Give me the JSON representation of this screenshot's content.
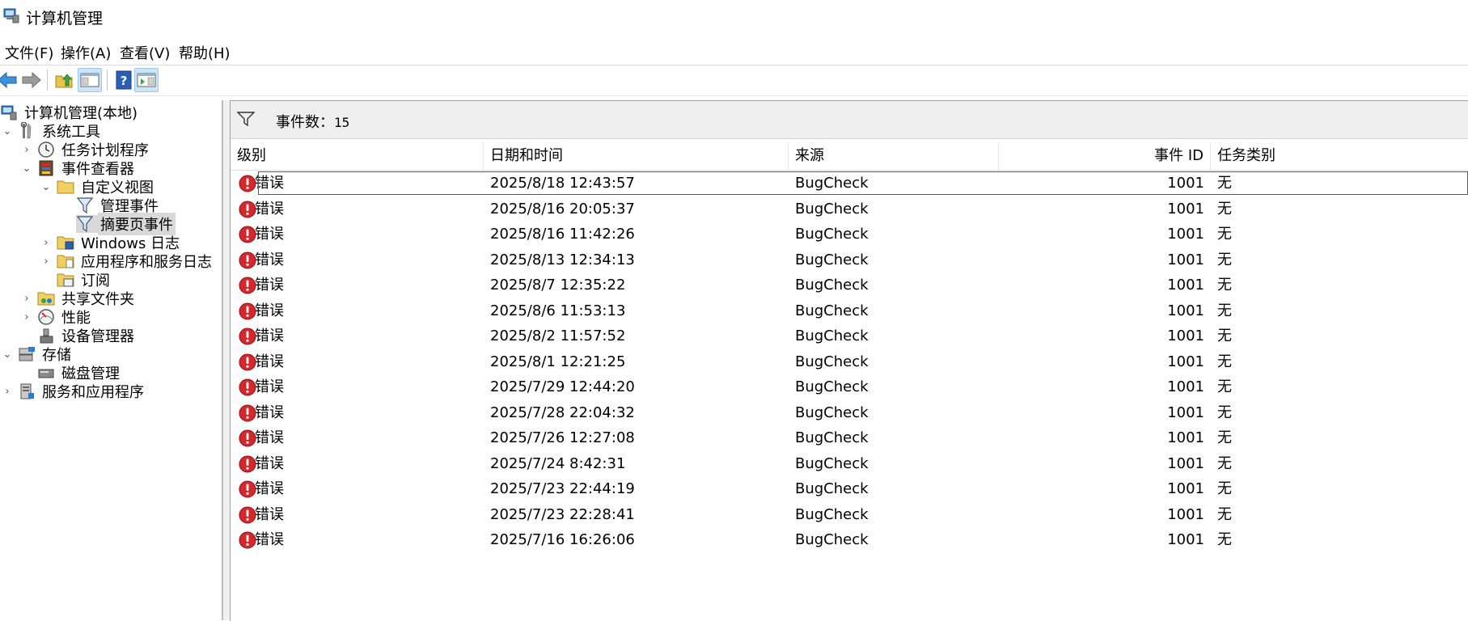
{
  "window": {
    "title": "计算机管理"
  },
  "menu": [
    "文件(F)",
    "操作(A)",
    "查看(V)",
    "帮助(H)"
  ],
  "toolbar": {
    "buttons": [
      "back-icon",
      "forward-icon",
      "up-folder-icon",
      "show-hide-tree-icon",
      "help-icon",
      "show-action-pane-icon"
    ]
  },
  "tree": {
    "root": "计算机管理(本地)",
    "system_tools": "系统工具",
    "task_scheduler": "任务计划程序",
    "event_viewer": "事件查看器",
    "custom_views": "自定义视图",
    "admin_events": "管理事件",
    "summary_events": "摘要页事件",
    "windows_logs": "Windows 日志",
    "app_service_logs": "应用程序和服务日志",
    "subscriptions": "订阅",
    "shared_folders": "共享文件夹",
    "performance": "性能",
    "device_manager": "设备管理器",
    "storage": "存储",
    "disk_management": "磁盘管理",
    "services_apps": "服务和应用程序"
  },
  "events": {
    "count_label": "事件数：",
    "count": "15",
    "columns": {
      "level": "级别",
      "datetime": "日期和时间",
      "source": "来源",
      "event_id": "事件 ID",
      "task_category": "任务类别"
    },
    "rows": [
      {
        "level": "错误",
        "datetime": "2025/8/18 12:43:57",
        "source": "BugCheck",
        "event_id": "1001",
        "task_category": "无"
      },
      {
        "level": "错误",
        "datetime": "2025/8/16 20:05:37",
        "source": "BugCheck",
        "event_id": "1001",
        "task_category": "无"
      },
      {
        "level": "错误",
        "datetime": "2025/8/16 11:42:26",
        "source": "BugCheck",
        "event_id": "1001",
        "task_category": "无"
      },
      {
        "level": "错误",
        "datetime": "2025/8/13 12:34:13",
        "source": "BugCheck",
        "event_id": "1001",
        "task_category": "无"
      },
      {
        "level": "错误",
        "datetime": "2025/8/7 12:35:22",
        "source": "BugCheck",
        "event_id": "1001",
        "task_category": "无"
      },
      {
        "level": "错误",
        "datetime": "2025/8/6 11:53:13",
        "source": "BugCheck",
        "event_id": "1001",
        "task_category": "无"
      },
      {
        "level": "错误",
        "datetime": "2025/8/2 11:57:52",
        "source": "BugCheck",
        "event_id": "1001",
        "task_category": "无"
      },
      {
        "level": "错误",
        "datetime": "2025/8/1 12:21:25",
        "source": "BugCheck",
        "event_id": "1001",
        "task_category": "无"
      },
      {
        "level": "错误",
        "datetime": "2025/7/29 12:44:20",
        "source": "BugCheck",
        "event_id": "1001",
        "task_category": "无"
      },
      {
        "level": "错误",
        "datetime": "2025/7/28 22:04:32",
        "source": "BugCheck",
        "event_id": "1001",
        "task_category": "无"
      },
      {
        "level": "错误",
        "datetime": "2025/7/26 12:27:08",
        "source": "BugCheck",
        "event_id": "1001",
        "task_category": "无"
      },
      {
        "level": "错误",
        "datetime": "2025/7/24 8:42:31",
        "source": "BugCheck",
        "event_id": "1001",
        "task_category": "无"
      },
      {
        "level": "错误",
        "datetime": "2025/7/23 22:44:19",
        "source": "BugCheck",
        "event_id": "1001",
        "task_category": "无"
      },
      {
        "level": "错误",
        "datetime": "2025/7/23 22:28:41",
        "source": "BugCheck",
        "event_id": "1001",
        "task_category": "无"
      },
      {
        "level": "错误",
        "datetime": "2025/7/16 16:26:06",
        "source": "BugCheck",
        "event_id": "1001",
        "task_category": "无"
      }
    ]
  },
  "colors": {
    "error_red": "#d7262c",
    "selection": "#d9d9d9",
    "toolbar_pressed": "#cce4f7"
  }
}
